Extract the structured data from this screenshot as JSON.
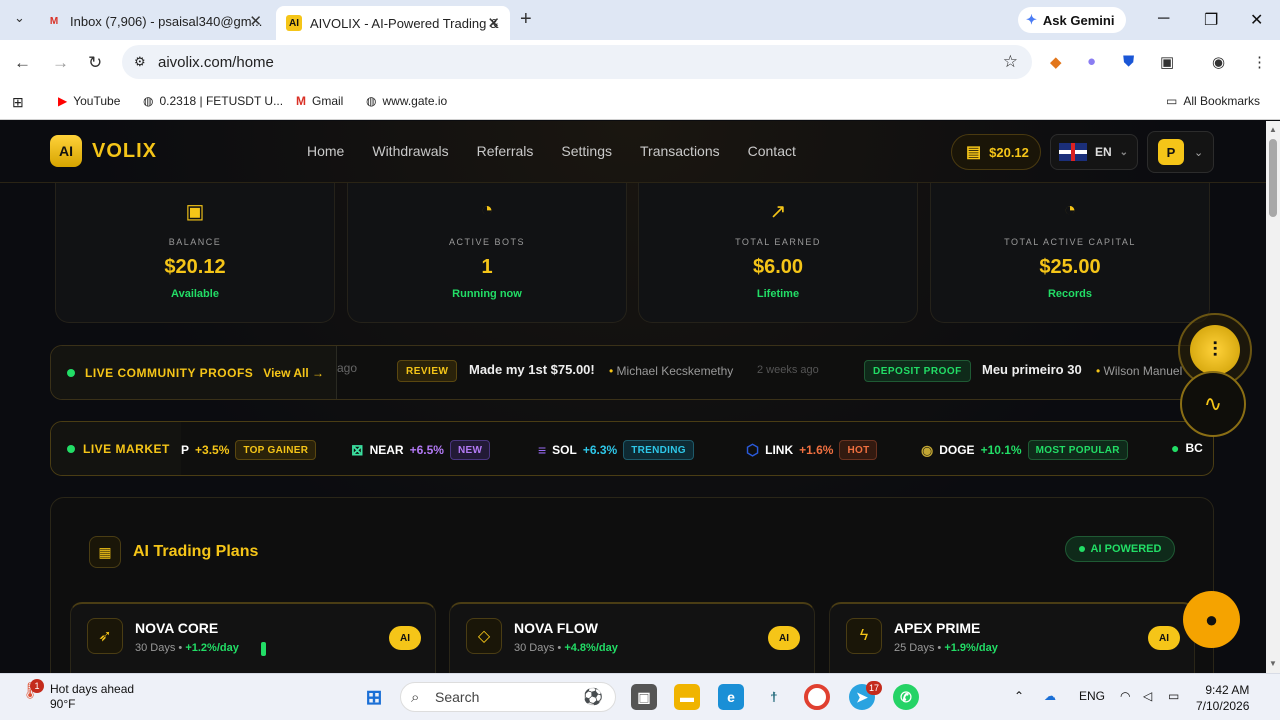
{
  "browser": {
    "tabs": [
      {
        "title": "Inbox (7,906) - psaisal340@gm..."
      },
      {
        "title": "AIVOLIX - AI-Powered Trading &"
      }
    ],
    "ask_gemini": "Ask Gemini",
    "url": "aivolix.com/home",
    "bookmarks": [
      {
        "label": "YouTube"
      },
      {
        "label": "0.2318 | FETUSDT U..."
      },
      {
        "label": "Gmail"
      },
      {
        "label": "www.gate.io"
      }
    ],
    "all_bookmarks": "All Bookmarks"
  },
  "site": {
    "logo_badge": "AI",
    "logo_name": "VOLIX",
    "nav": [
      "Home",
      "Withdrawals",
      "Referrals",
      "Settings",
      "Transactions",
      "Contact"
    ],
    "balance_pill": "$20.12",
    "language": "EN",
    "user_initial": "P"
  },
  "stats": [
    {
      "label": "BALANCE",
      "value": "$20.12",
      "sub": "Available",
      "icon": "wallet-icon"
    },
    {
      "label": "ACTIVE BOTS",
      "value": "1",
      "sub": "Running now",
      "icon": "pie-chart-icon"
    },
    {
      "label": "TOTAL EARNED",
      "value": "$6.00",
      "sub": "Lifetime",
      "icon": "trending-up-icon"
    },
    {
      "label": "TOTAL ACTIVE CAPITAL",
      "value": "$25.00",
      "sub": "Records",
      "icon": "pie-chart-icon"
    }
  ],
  "proofs": {
    "title": "LIVE COMMUNITY PROOFS",
    "view_all": "View All →",
    "fragment": "ago",
    "items": [
      {
        "badge": "REVIEW",
        "text": "Made my 1st $75.00!",
        "name": "Michael Kecskemethy",
        "time": "2 weeks ago"
      },
      {
        "badge": "DEPOSIT PROOF",
        "text": "Meu primeiro 30",
        "name": "Wilson Manuel"
      }
    ]
  },
  "market": {
    "title": "LIVE MARKET",
    "items": [
      {
        "symbol": "P",
        "change": "+3.5%",
        "tag": "TOP GAINER"
      },
      {
        "symbol": "NEAR",
        "change": "+6.5%",
        "tag": "NEW"
      },
      {
        "symbol": "SOL",
        "change": "+6.3%",
        "tag": "TRENDING"
      },
      {
        "symbol": "LINK",
        "change": "+1.6%",
        "tag": "HOT"
      },
      {
        "symbol": "DOGE",
        "change": "+10.1%",
        "tag": "MOST POPULAR"
      },
      {
        "symbol": "BC",
        "change": "",
        "tag": ""
      }
    ]
  },
  "plans": {
    "title": "AI Trading Plans",
    "badge": "AI POWERED",
    "cards": [
      {
        "name": "NOVA CORE",
        "days": "30 Days",
        "rate": "+1.2%/day",
        "tag": "AI"
      },
      {
        "name": "NOVA FLOW",
        "days": "30 Days",
        "rate": "+4.8%/day",
        "tag": "AI"
      },
      {
        "name": "APEX PRIME",
        "days": "25 Days",
        "rate": "+1.9%/day",
        "tag": "AI"
      }
    ]
  },
  "taskbar": {
    "weather_title": "Hot days ahead",
    "weather_temp": "90°F",
    "weather_badge": "1",
    "search": "Search",
    "telegram_badge": "17",
    "lang": "ENG",
    "time": "9:42 AM",
    "date": "7/10/2026"
  },
  "colors": {
    "accent": "#f5c518",
    "positive": "#22dd66",
    "background": "#0b0c10"
  }
}
